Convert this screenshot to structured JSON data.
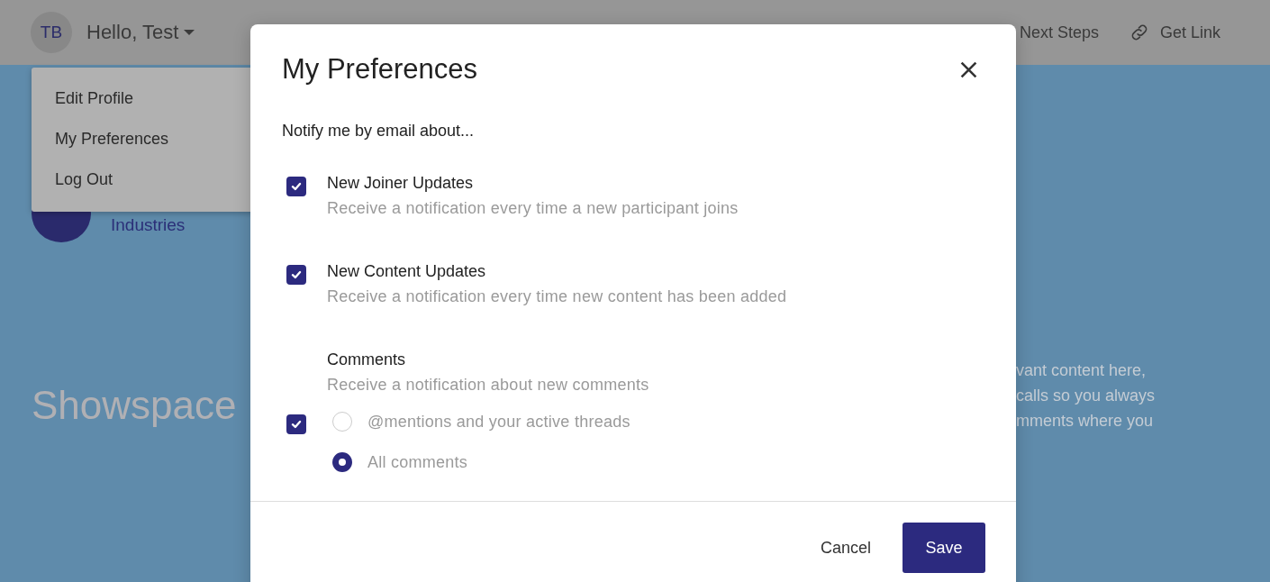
{
  "header": {
    "avatar_initials": "TB",
    "greeting": "Hello, Test",
    "actions": [
      {
        "kind": "plain",
        "label": "Next Steps"
      },
      {
        "kind": "link",
        "label": "Get Link"
      }
    ]
  },
  "user_menu": {
    "items": [
      {
        "label": "Edit Profile"
      },
      {
        "label": "My Preferences"
      },
      {
        "label": "Log Out"
      }
    ]
  },
  "page": {
    "company_name": "Industries",
    "hero_title": "Showspace",
    "hero_text": [
      "vant content here,",
      "calls so you always",
      "mments where you"
    ]
  },
  "modal": {
    "title": "My Preferences",
    "section_label": "Notify me by email about...",
    "options": [
      {
        "title": "New Joiner Updates",
        "description": "Receive a notification every time a new participant joins",
        "checked": true
      },
      {
        "title": "New Content Updates",
        "description": "Receive a notification every time new content has been added",
        "checked": true
      },
      {
        "title": "Comments",
        "description": "Receive a notification about new comments",
        "checked": true,
        "choices": [
          {
            "label": "@mentions and your active threads",
            "selected": false
          },
          {
            "label": "All comments",
            "selected": true
          }
        ]
      }
    ],
    "cancel_label": "Cancel",
    "save_label": "Save"
  }
}
